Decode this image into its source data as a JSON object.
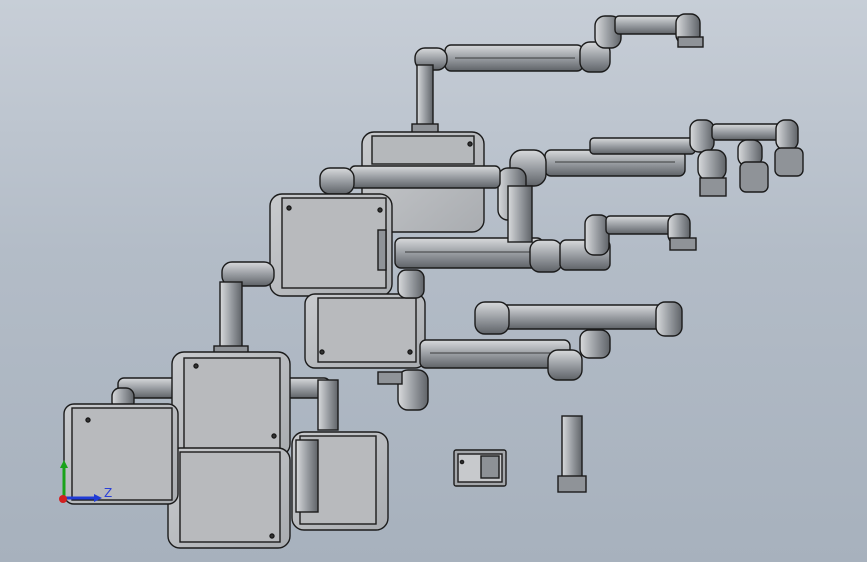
{
  "viewport": {
    "background_top": "#c7ced7",
    "background_bottom": "#a7b1bd",
    "part_fill": "#9ea2a7",
    "part_fill_light": "#c3c6ca",
    "box_face": "#b8babd",
    "edge_color": "#1b1b1b"
  },
  "triad": {
    "z_label": "Z",
    "z_color": "#1f3bd6",
    "y_color": "#1aa31a",
    "origin_color": "#d22020"
  },
  "icons": {
    "triad": "coordinate-triad-icon"
  }
}
